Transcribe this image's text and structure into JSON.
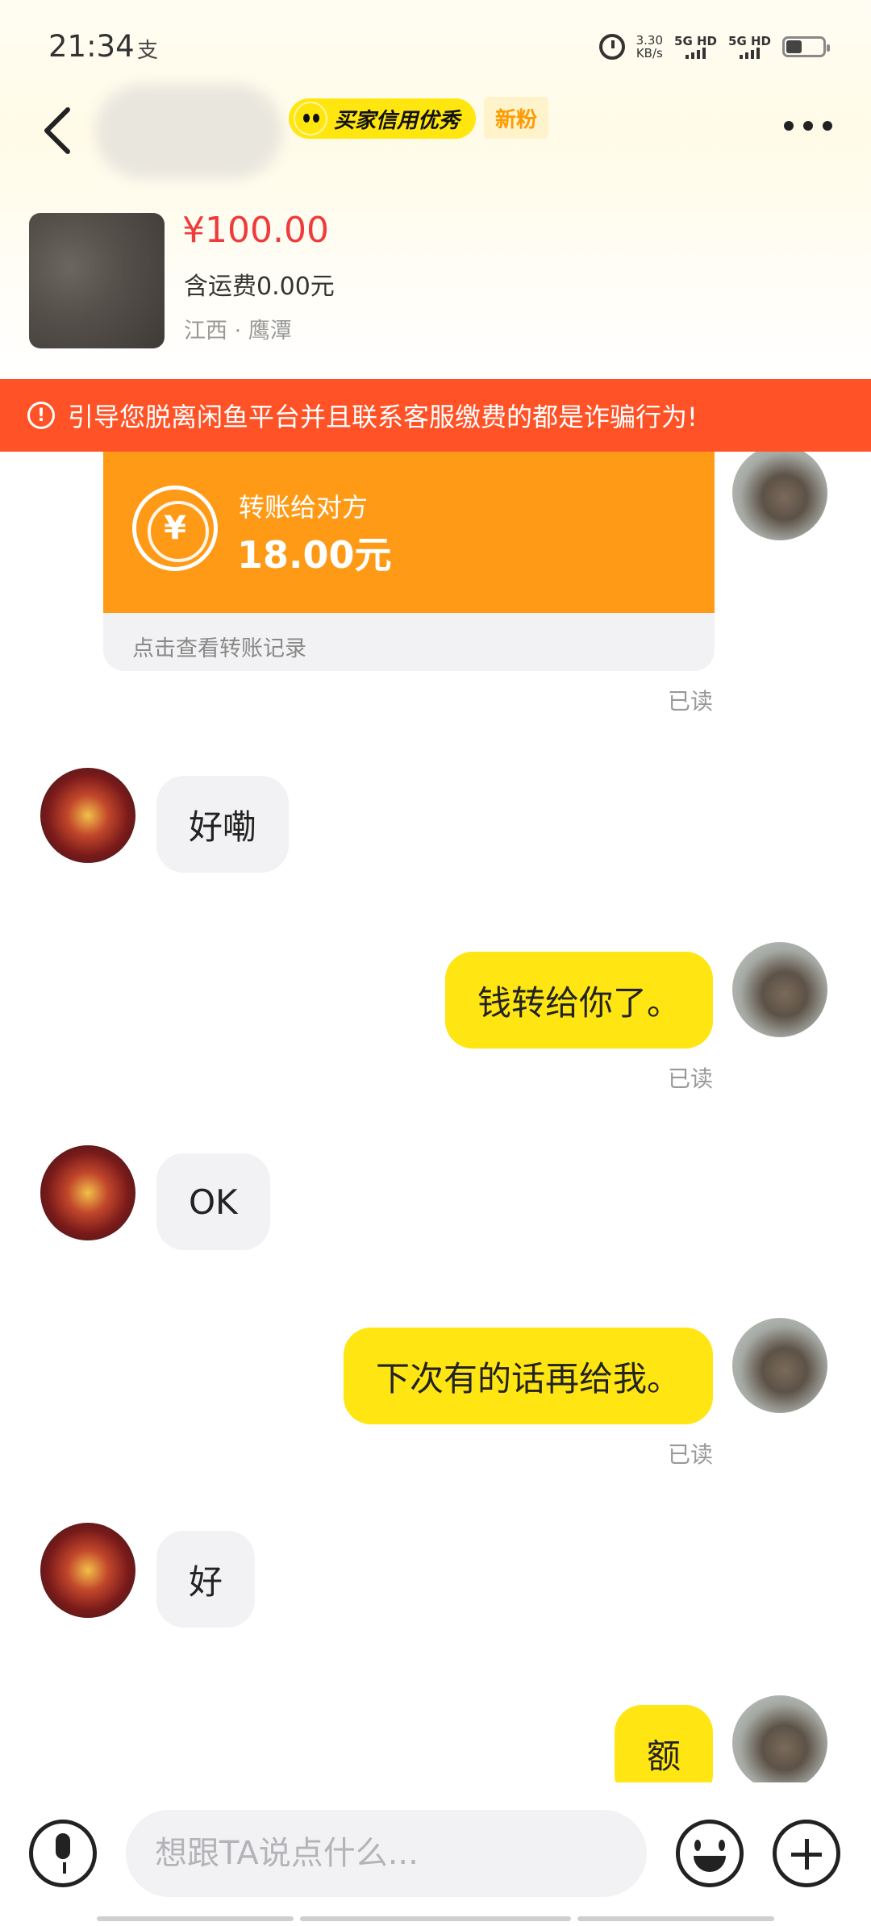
{
  "status_bar": {
    "time": "21:34",
    "pay_icon_text": "支",
    "net_speed_value": "3.30",
    "net_speed_unit": "KB/s",
    "signal1": "5G HD",
    "signal2": "5G HD"
  },
  "header": {
    "credit_badge": "买家信用优秀",
    "new_fan_tag": "新粉"
  },
  "product": {
    "price": "¥100.00",
    "shipping": "含运费0.00元",
    "location": "江西 · 鹰潭"
  },
  "warning": {
    "icon": "!",
    "text": "引导您脱离闲鱼平台并且联系客服缴费的都是诈骗行为!"
  },
  "transfer": {
    "icon_symbol": "¥",
    "label": "转账给对方",
    "amount": "18.00元",
    "link": "点击查看转账记录",
    "read": "已读"
  },
  "messages": [
    {
      "from": "other",
      "text": "好嘞"
    },
    {
      "from": "me",
      "text": "钱转给你了。",
      "read": "已读"
    },
    {
      "from": "other",
      "text": "OK"
    },
    {
      "from": "me",
      "text": "下次有的话再给我。",
      "read": "已读"
    },
    {
      "from": "other",
      "text": "好"
    },
    {
      "from": "me",
      "text": "额"
    }
  ],
  "input": {
    "placeholder": "想跟TA说点什么..."
  },
  "colors": {
    "accent_yellow": "#ffe512",
    "warning_orange": "#ff5226",
    "transfer_orange": "#ff9a17",
    "price_red": "#ee3c3c"
  }
}
